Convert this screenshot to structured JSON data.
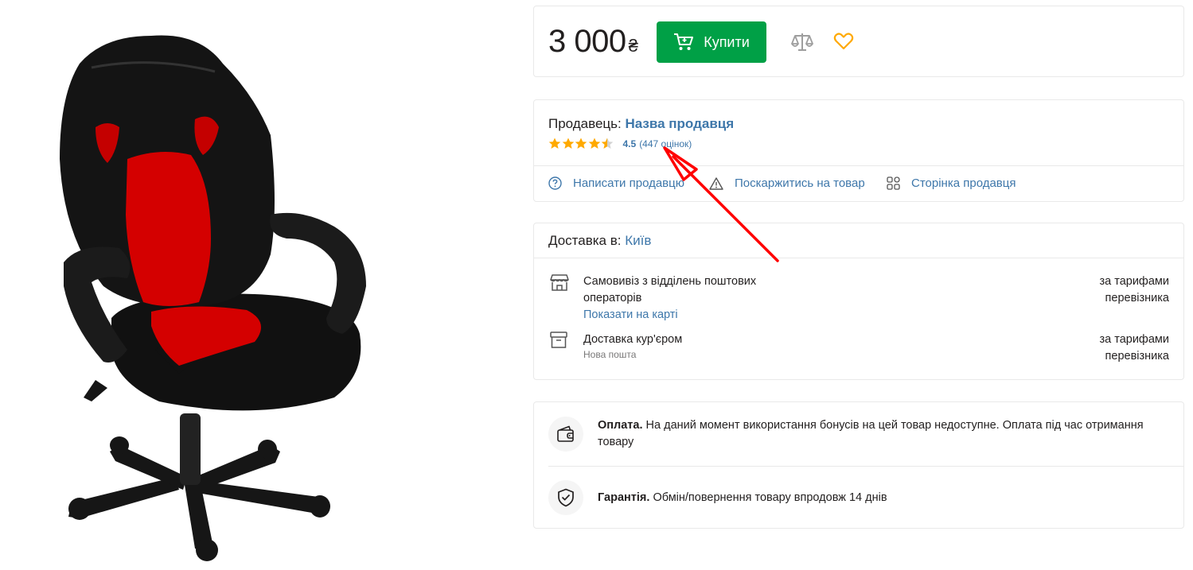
{
  "product": {
    "image_alt": "Black and red gaming office chair"
  },
  "price_block": {
    "price": "3 000",
    "currency": "₴",
    "buy_label": "Купити"
  },
  "seller": {
    "label": "Продавець:",
    "name": "Назва продавця",
    "rating": "4.5",
    "reviews": "(447 оцінок)",
    "stars_filled": 4.5,
    "stars_total": 5,
    "actions": [
      {
        "label": "Написати продавцю",
        "icon": "help-circle-icon"
      },
      {
        "label": "Поскаржитись на товар",
        "icon": "warning-icon"
      },
      {
        "label": "Сторінка продавця",
        "icon": "grid-icon"
      }
    ]
  },
  "delivery": {
    "label": "Доставка в:",
    "city": "Київ",
    "options": [
      {
        "title": "Самовивіз з відділень поштових операторів",
        "link": "Показати на карті",
        "price": "за тарифами перевізника",
        "icon": "store-icon"
      },
      {
        "title": "Доставка кур'єром",
        "sub": "Нова пошта",
        "price": "за тарифами перевізника",
        "icon": "box-icon"
      }
    ]
  },
  "info": {
    "payment_title": "Оплата.",
    "payment_text": "На даний момент використання бонусів на цей товар недоступне. Оплата під час отримання товару",
    "warranty_title": "Гарантія.",
    "warranty_text": "Обмін/повернення товару впродовж 14 днів"
  },
  "colors": {
    "accent_green": "#00a046",
    "link_blue": "#3e77aa",
    "star_gold": "#ffa900",
    "annotation_red": "#ff0000"
  }
}
